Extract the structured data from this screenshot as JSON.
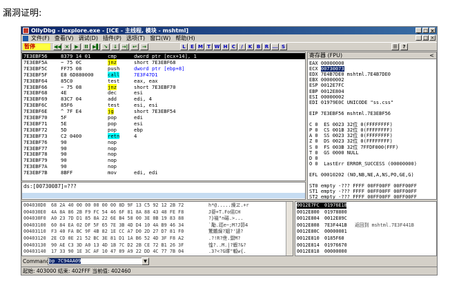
{
  "caption": "漏洞证明:",
  "window": {
    "title": "OllyDbg - iexplore.exe - [ICE - 主线程, 模块 - mshtml]",
    "title_buttons": [
      "_",
      "□",
      "×"
    ],
    "mdi_buttons": [
      "_",
      "□",
      "×"
    ]
  },
  "menu": [
    "文件(F)",
    "查看(V)",
    "调试(D)",
    "插件(P)",
    "选项(T)",
    "窗口(W)",
    "帮助(H)"
  ],
  "toolbar": {
    "status": "暂停",
    "controls": [
      "◀◀",
      "×",
      "▶",
      "II",
      "▶▌",
      "↘",
      "↓",
      "→|",
      "↩",
      "→"
    ],
    "letters": [
      "L",
      "E",
      "M",
      "T",
      "W",
      "H",
      "C",
      "/",
      "K",
      "B",
      "R",
      "...",
      "S"
    ],
    "right_icons": [
      "☰",
      "?"
    ]
  },
  "disasm": {
    "rows": [
      {
        "addr": "7E3EBF56",
        "hex": "8379 14 01",
        "mn": "cmp",
        "op": "dword ptr [ecx+14], 1",
        "sel": true
      },
      {
        "addr": "7E3EBF5A",
        "hex": "~ 75 0C",
        "mn": "jnz",
        "op": "short 7E3EBF68",
        "kind": "jmp"
      },
      {
        "addr": "7E3EBF5C",
        "hex": "FF75 08",
        "mn": "push",
        "op": "dword ptr [ebp+8]",
        "kind": "blue"
      },
      {
        "addr": "7E3EBF5F",
        "hex": "E8 6D880000",
        "mn": "call",
        "op": "7E3F47D1",
        "kind": "call"
      },
      {
        "addr": "7E3EBF64",
        "hex": "85C0",
        "mn": "test",
        "op": "eax, eax"
      },
      {
        "addr": "7E3EBF66",
        "hex": "~ 75 08",
        "mn": "jnz",
        "op": "short 7E3EBF70",
        "kind": "jmp"
      },
      {
        "addr": "7E3EBF68",
        "hex": "4E",
        "mn": "dec",
        "op": "esi"
      },
      {
        "addr": "7E3EBF69",
        "hex": "83C7 04",
        "mn": "add",
        "op": "edi, 4"
      },
      {
        "addr": "7E3EBF6C",
        "hex": "85F6",
        "mn": "test",
        "op": "esi, esi"
      },
      {
        "addr": "7E3EBF6E",
        "hex": "^ 7F E4",
        "mn": "jg",
        "op": "short 7E3EBF54",
        "kind": "jmp"
      },
      {
        "addr": "7E3EBF70",
        "hex": "5F",
        "mn": "pop",
        "op": "edi"
      },
      {
        "addr": "7E3EBF71",
        "hex": "5E",
        "mn": "pop",
        "op": "esi"
      },
      {
        "addr": "7E3EBF72",
        "hex": "5D",
        "mn": "pop",
        "op": "ebp"
      },
      {
        "addr": "7E3EBF73",
        "hex": "C2 0400",
        "mn": "retn",
        "op": "4",
        "kind": "ret"
      },
      {
        "addr": "7E3EBF76",
        "hex": "90",
        "mn": "nop",
        "op": ""
      },
      {
        "addr": "7E3EBF77",
        "hex": "90",
        "mn": "nop",
        "op": ""
      },
      {
        "addr": "7E3EBF78",
        "hex": "90",
        "mn": "nop",
        "op": ""
      },
      {
        "addr": "7E3EBF79",
        "hex": "90",
        "mn": "nop",
        "op": ""
      },
      {
        "addr": "7E3EBF7A",
        "hex": "90",
        "mn": "nop",
        "op": ""
      },
      {
        "addr": "7E3EBF7B",
        "hex": "8BFF",
        "mn": "mov",
        "op": "edi, edi"
      }
    ]
  },
  "info": {
    "text": "ds:[00730087]=???"
  },
  "registers": {
    "header": "寄存器 (FPU)",
    "chevron": "<",
    "lines": [
      "EAX 00000000",
      "ECX 00730073",
      "EDX 7E4B7DE0 mshtml.7E4B7DE0",
      "EBX 00000002",
      "ESP 0012E7FC",
      "EBP 0012E804",
      "ESI 00000002",
      "EDI 01979E0C UNICODE \"ss.css\"",
      "",
      "EIP 7E3EBF56 mshtml.7E3EBF56",
      "",
      "C 0  ES 0023 32位 0(FFFFFFFF)",
      "P 0  CS 001B 32位 0(FFFFFFFF)",
      "A 0  SS 0023 32位 0(FFFFFFFF)",
      "Z 0  DS 0023 32位 0(FFFFFFFF)",
      "S 0  FS 003B 32位 7FFDF000(FFF)",
      "T 0  GS 0000 NULL",
      "D 0",
      "O 0  LastErr ERROR_SUCCESS (00000000)",
      "",
      "EFL 00010202 (NO,NB,NE,A,NS,PO,GE,G)",
      "",
      "ST0 empty -??? FFFF 00FF00FF 00FF00FF",
      "ST1 empty -??? FFFF 00FF00FF 00FF00FF",
      "ST2 empty -??? FFFF 00FF00FF 00FF00FF"
    ]
  },
  "dump": {
    "rows": [
      {
        "addr": "004030D0",
        "hex": "68 2A 40 00 00 00 00 00 8D 9F 13 C5 92 12 2B 72",
        "asc": "h*@.....燥ヱ.+r"
      },
      {
        "addr": "004030E0",
        "hex": "4A 8A 86 2B F9 FC 54 46 6F 81 8A 88 43 48 FE F8",
        "asc": "J妴+Т.Fo傜CH"
      },
      {
        "addr": "004030F0",
        "hex": "A0 23 7D D1 85 8A 22 6E B4 58 00 3E 0B 19 83 88",
        "asc": "?}褦\"n碭.>..."
      },
      {
        "addr": "00403100",
        "hex": "60 84 EA 02 DF 5F 65 7E 3B 4D D4 10 4A B9 46 34",
        "asc": "`勱.踎e~;M?J笷4"
      },
      {
        "addr": "00403110",
        "hex": "F3 40 FA BC 9F 4B 82 1E CC A7 D0 2D 27 D7 81 F0",
        "asc": "驚鷳焗?姻?'讉?"
      },
      {
        "addr": "00403120",
        "hex": "2E CD 0E 21 52 BC 3E 81 D1 1A B6 52 4D 3F F8 A2",
        "asc": ".?!R?伳.禦M?"
      },
      {
        "addr": "00403130",
        "hex": "90 AE C3 3D A0 13 4D 1B 7C D2 2B CE 72 B1 26 3F",
        "asc": "惍?..M.|?蝦?&?"
      },
      {
        "addr": "00403140",
        "hex": "17 33 90 1E 3C AF 10 47 89 A9 22 DD 4C 77 7B 04",
        "asc": ".3?<?G墿\"軱w{."
      }
    ]
  },
  "stack": {
    "rows": [
      {
        "addr": "0012E7FC",
        "val": "01976E18",
        "com": "",
        "sel": true
      },
      {
        "addr": "0012E800",
        "val": "01978800",
        "com": ""
      },
      {
        "addr": "0012E804",
        "val": "0012E89C",
        "com": ""
      },
      {
        "addr": "0012E808",
        "val": "7E3F441B",
        "com": "返回到 mshtml.7E3F441B"
      },
      {
        "addr": "0012E80C",
        "val": "00000001",
        "com": ""
      },
      {
        "addr": "0012E810",
        "val": "0185F60",
        "com": ""
      },
      {
        "addr": "0012E814",
        "val": "01976670",
        "com": ""
      },
      {
        "addr": "0012E818",
        "val": "00000000",
        "com": ""
      }
    ]
  },
  "command": {
    "label": "Command",
    "value": "bp 7C94AA09"
  },
  "status": "起始: 403000 结束: 402FFF 当前值: 402460"
}
